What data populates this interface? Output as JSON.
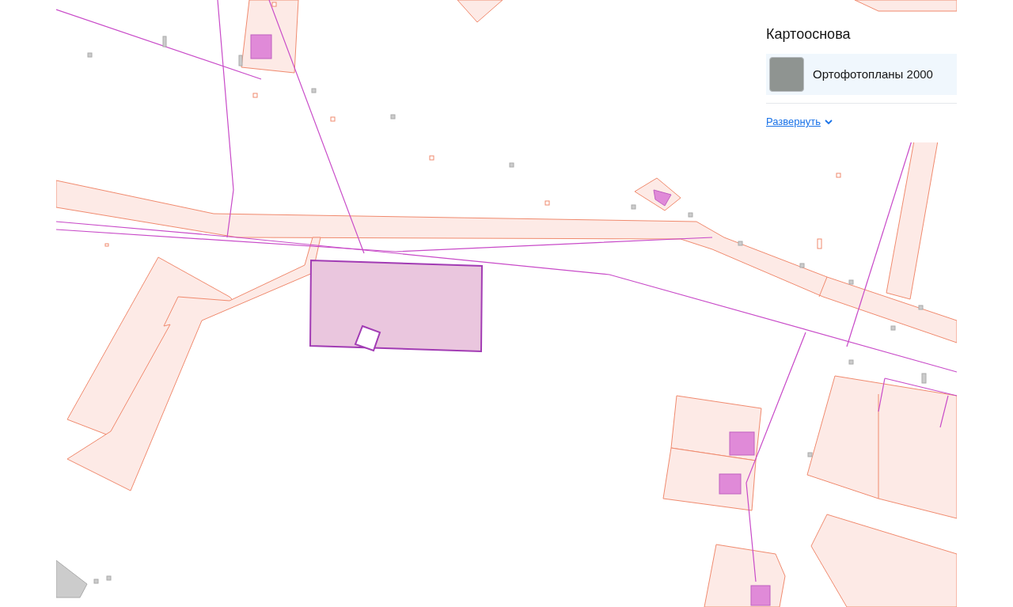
{
  "basemap_panel": {
    "title": "Картооснова",
    "layers": [
      {
        "label": "Ортофотопланы 2000",
        "selected": true
      }
    ],
    "expand_link": "Развернуть"
  }
}
